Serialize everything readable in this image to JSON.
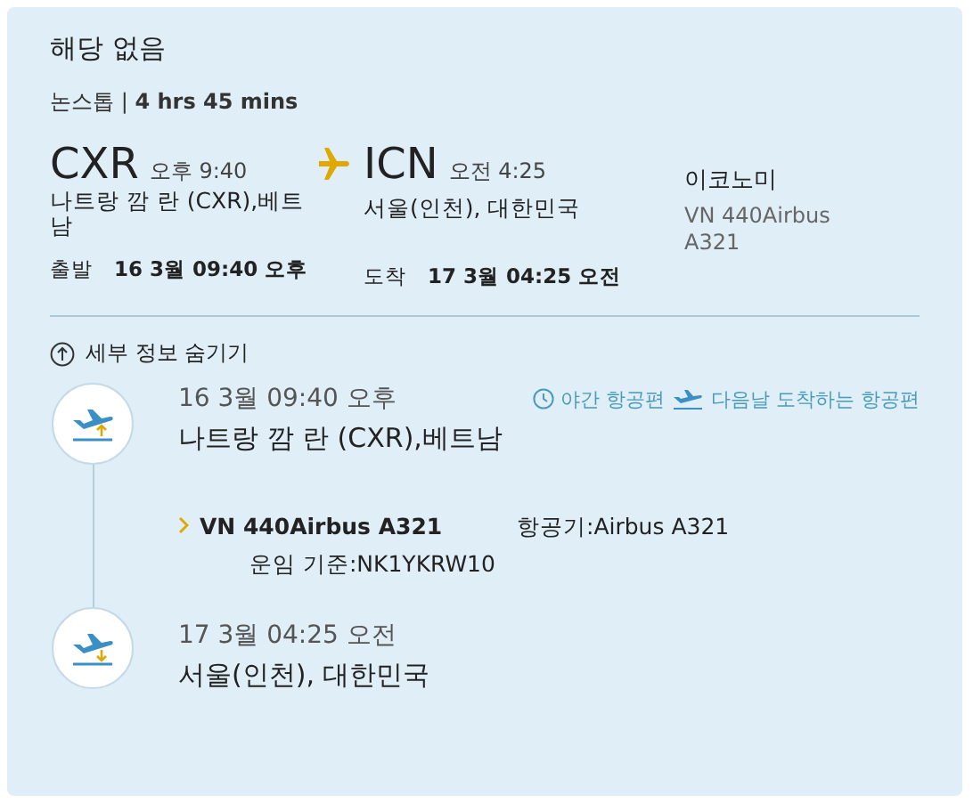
{
  "title": "해당 없음",
  "summary": {
    "stops": "논스톱",
    "separator": "|",
    "duration": "4 hrs 45 mins"
  },
  "departure": {
    "code": "CXR",
    "time": "오후 9:40",
    "city": "나트랑 깜 란 (CXR),베트남",
    "label": "출발",
    "datetime": "16 3월 09:40 오후"
  },
  "arrival": {
    "code": "ICN",
    "time": "오전 4:25",
    "city": "서울(인천), 대한민국",
    "label": "도착",
    "datetime": "17 3월 04:25 오전"
  },
  "cabin": {
    "class": "이코노미",
    "flight": "VN 440Airbus A321"
  },
  "details_toggle": {
    "label": "세부 정보 숨기기",
    "expanded": true
  },
  "timeline": [
    {
      "kind": "depart",
      "datetime": "16 3월 09:40 오후",
      "place": "나트랑 깜 란 (CXR),베트남"
    },
    {
      "kind": "arrive",
      "datetime": "17 3월 04:25 오전",
      "place": "서울(인천), 대한민국"
    }
  ],
  "badges": [
    {
      "kind": "night",
      "label": "야간 항공편"
    },
    {
      "kind": "next_day",
      "label": "다음날 도착하는 항공편"
    }
  ],
  "segment": {
    "flight": "VN 440Airbus A321",
    "aircraft": "항공기:Airbus A321",
    "fare_basis": "운임 기준:NK1YKRW10"
  }
}
